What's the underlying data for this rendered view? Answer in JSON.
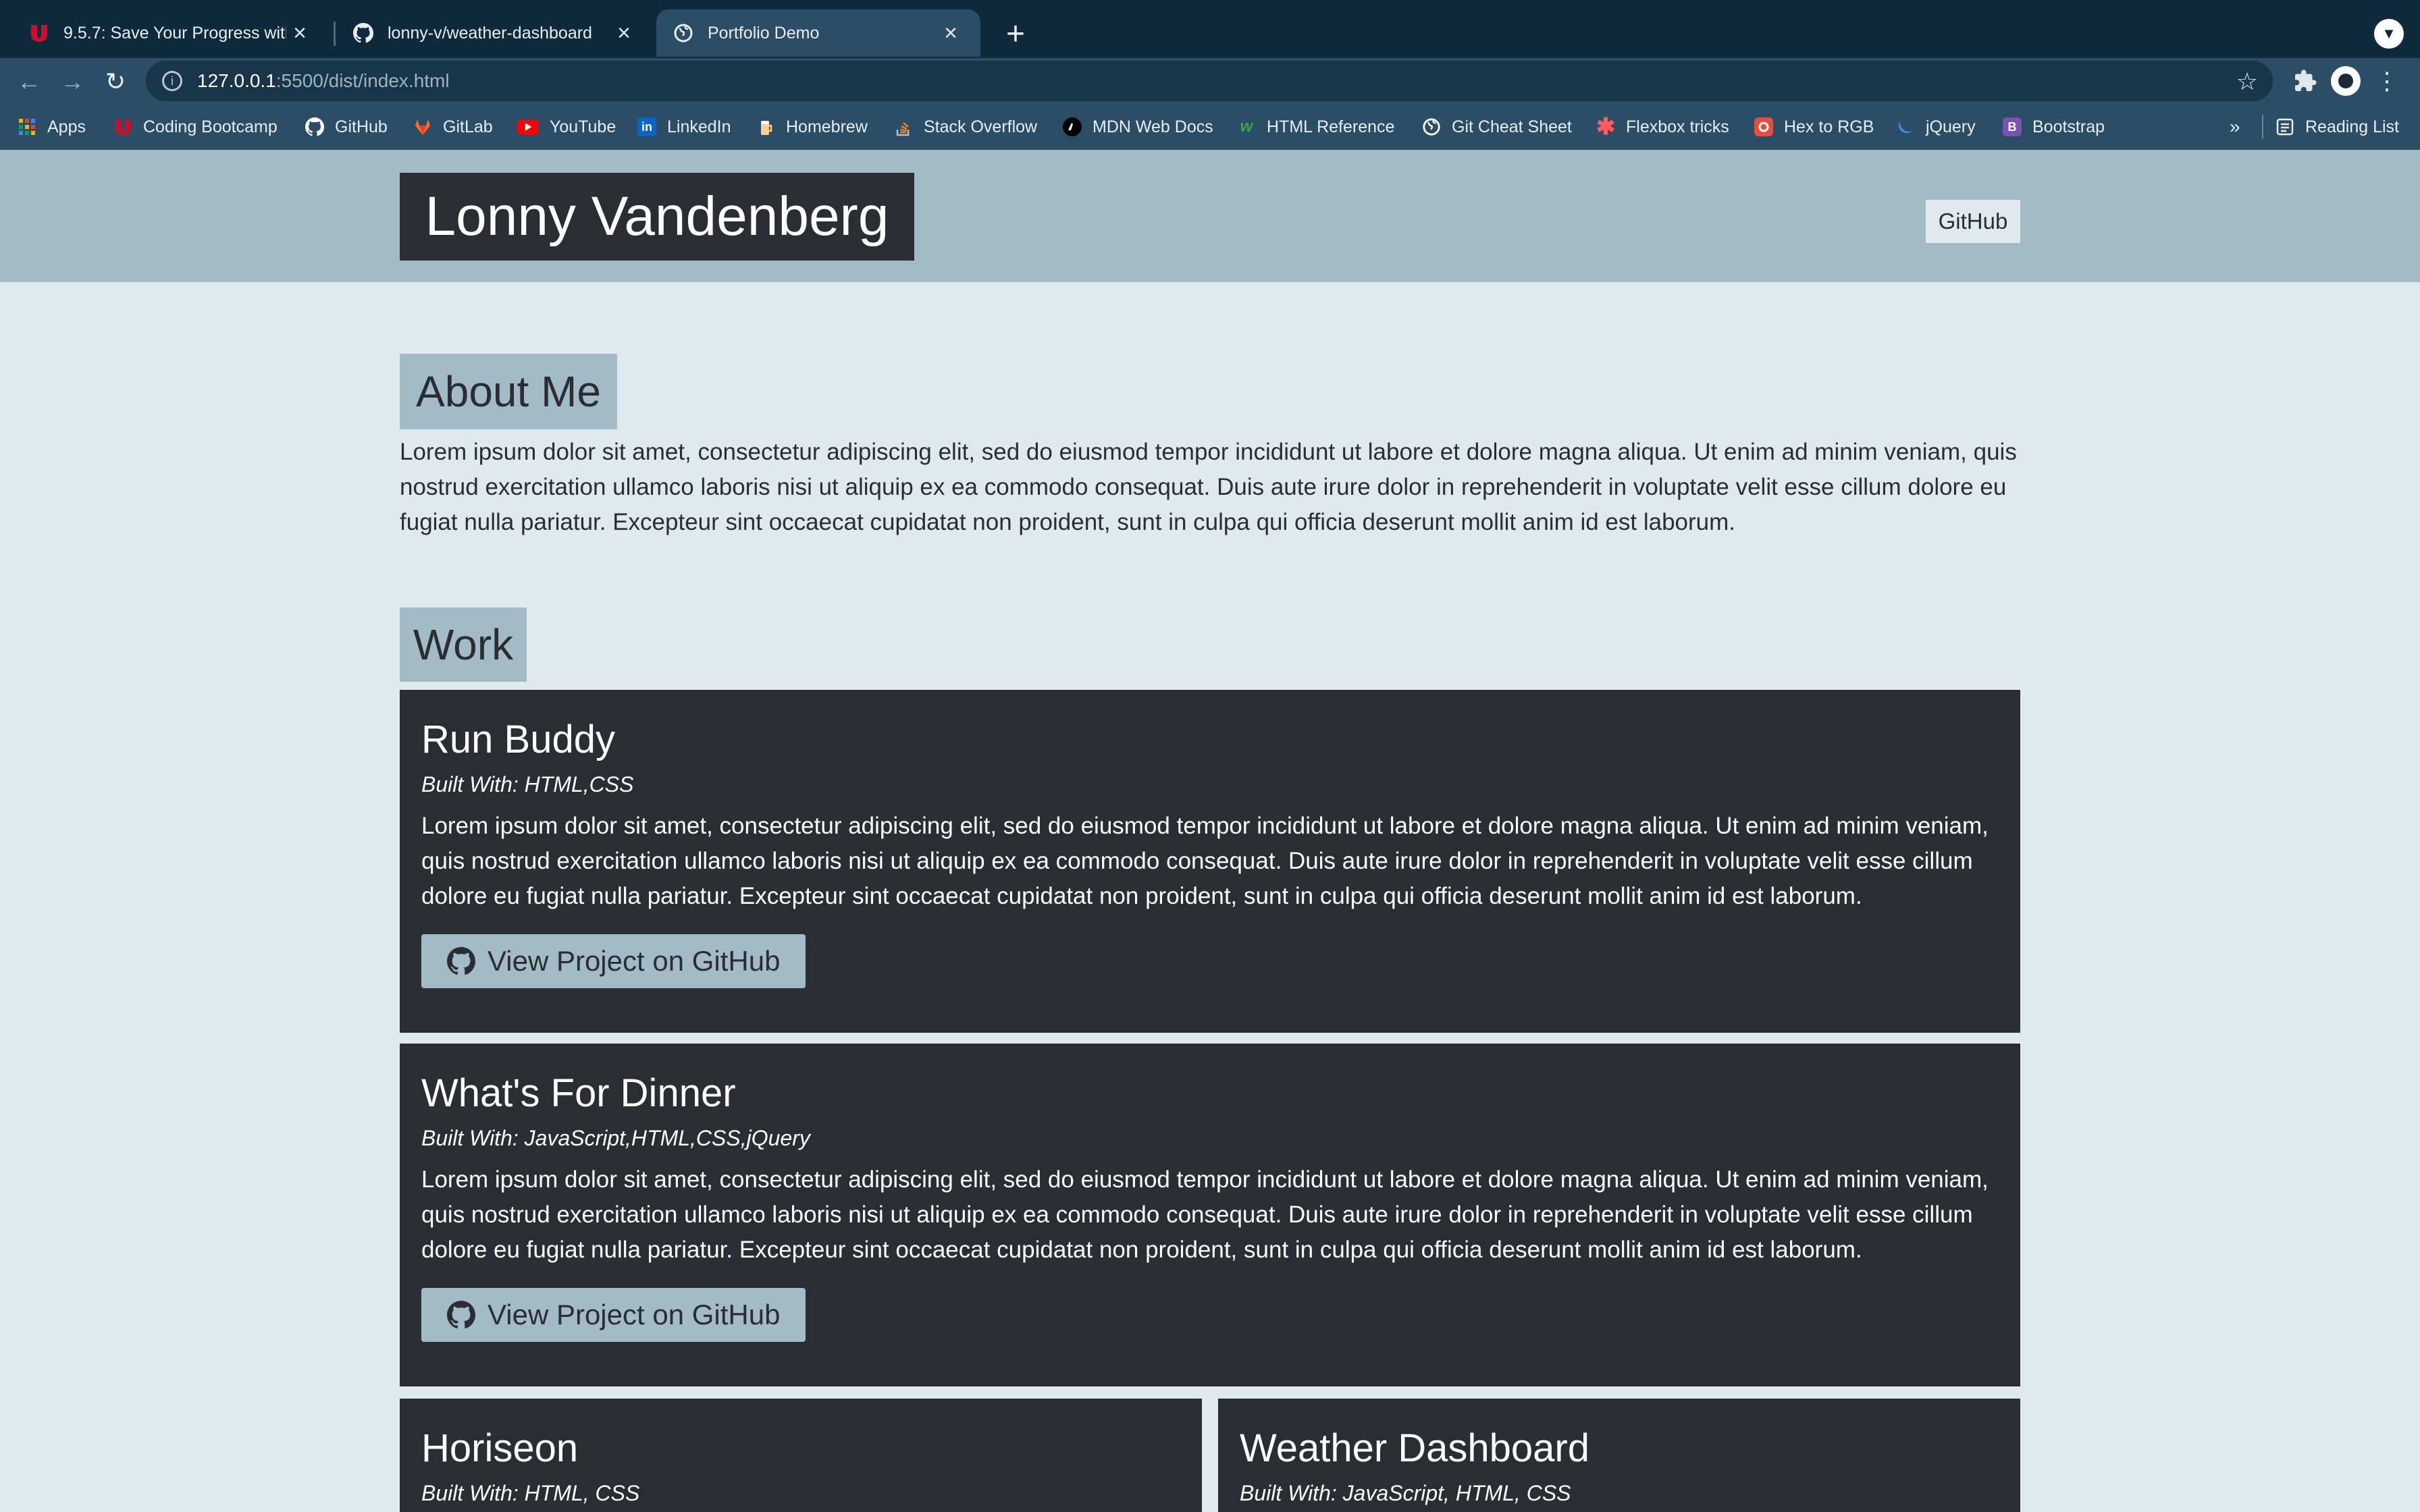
{
  "browser": {
    "tabs": [
      {
        "title": "9.5.7: Save Your Progress with",
        "icon": "bootcamp-u-icon",
        "active": false
      },
      {
        "title": "lonny-v/weather-dashboard",
        "icon": "github-icon",
        "active": false
      },
      {
        "title": "Portfolio Demo",
        "icon": "globe-icon",
        "active": true
      }
    ],
    "new_tab_label": "+",
    "address": {
      "host": "127.0.0.1",
      "path": ":5500/dist/index.html"
    },
    "bookmarks": [
      {
        "label": "Apps",
        "icon": "apps-grid-icon",
        "color": "#f4b400"
      },
      {
        "label": "Coding Bootcamp",
        "icon": "bootcamp-u-icon",
        "color": "#c8102e"
      },
      {
        "label": "GitHub",
        "icon": "github-icon",
        "color": "#ffffff"
      },
      {
        "label": "GitLab",
        "icon": "gitlab-icon",
        "color": "#fc6d26"
      },
      {
        "label": "YouTube",
        "icon": "youtube-icon",
        "color": "#ff0000"
      },
      {
        "label": "LinkedIn",
        "icon": "linkedin-icon",
        "color": "#0a66c2"
      },
      {
        "label": "Homebrew",
        "icon": "homebrew-icon",
        "color": "#f9d094"
      },
      {
        "label": "Stack Overflow",
        "icon": "stackoverflow-icon",
        "color": "#f48024"
      },
      {
        "label": "MDN Web Docs",
        "icon": "mdn-icon",
        "color": "#000000"
      },
      {
        "label": "HTML Reference",
        "icon": "html-reference-icon",
        "color": "#3fa34d"
      },
      {
        "label": "Git Cheat Sheet",
        "icon": "globe-icon",
        "color": "#ffffff"
      },
      {
        "label": "Flexbox tricks",
        "icon": "flexbox-asterisk-icon",
        "color": "#ff5a5f"
      },
      {
        "label": "Hex to RGB",
        "icon": "hex-to-rgb-icon",
        "color": "#e84c3d"
      },
      {
        "label": "jQuery",
        "icon": "jquery-icon",
        "color": "#0769ad"
      },
      {
        "label": "Bootstrap",
        "icon": "bootstrap-icon",
        "color": "#7952b3"
      }
    ],
    "bookmarks_overflow": "»",
    "reading_list": "Reading List"
  },
  "header": {
    "name": "Lonny Vandenberg",
    "nav_link": "GitHub"
  },
  "about": {
    "heading": "About Me",
    "text": "Lorem ipsum dolor sit amet, consectetur adipiscing elit, sed do eiusmod tempor incididunt ut labore et dolore magna aliqua. Ut enim ad minim veniam, quis nostrud exercitation ullamco laboris nisi ut aliquip ex ea commodo consequat. Duis aute irure dolor in reprehenderit in voluptate velit esse cillum dolore eu fugiat nulla pariatur. Excepteur sint occaecat cupidatat non proident, sunt in culpa qui officia deserunt mollit anim id est laborum."
  },
  "work": {
    "heading": "Work",
    "projects": [
      {
        "title": "Run Buddy",
        "built_with": "Built With: HTML,CSS",
        "description": "Lorem ipsum dolor sit amet, consectetur adipiscing elit, sed do eiusmod tempor incididunt ut labore et dolore magna aliqua. Ut enim ad minim veniam, quis nostrud exercitation ullamco laboris nisi ut aliquip ex ea commodo consequat. Duis aute irure dolor in reprehenderit in voluptate velit esse cillum dolore eu fugiat nulla pariatur. Excepteur sint occaecat cupidatat non proident, sunt in culpa qui officia deserunt mollit anim id est laborum.",
        "button": "View Project on GitHub"
      },
      {
        "title": "What's For Dinner",
        "built_with": "Built With: JavaScript,HTML,CSS,jQuery",
        "description": "Lorem ipsum dolor sit amet, consectetur adipiscing elit, sed do eiusmod tempor incididunt ut labore et dolore magna aliqua. Ut enim ad minim veniam, quis nostrud exercitation ullamco laboris nisi ut aliquip ex ea commodo consequat. Duis aute irure dolor in reprehenderit in voluptate velit esse cillum dolore eu fugiat nulla pariatur. Excepteur sint occaecat cupidatat non proident, sunt in culpa qui officia deserunt mollit anim id est laborum.",
        "button": "View Project on GitHub"
      },
      {
        "title": "Horiseon",
        "built_with": "Built With: HTML, CSS"
      },
      {
        "title": "Weather Dashboard",
        "built_with": "Built With: JavaScript, HTML, CSS"
      }
    ]
  },
  "colors": {
    "header_bg": "#a3bbc6",
    "page_bg": "#dfe9ee",
    "dark": "#2a2e33"
  }
}
